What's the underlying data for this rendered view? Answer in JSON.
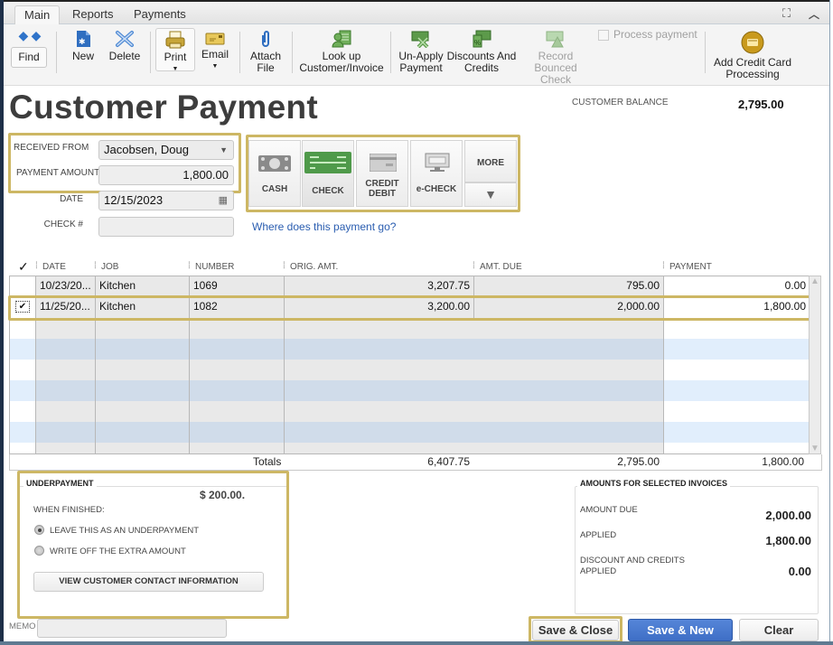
{
  "tabs": [
    {
      "label": "Main",
      "active": true
    },
    {
      "label": "Reports",
      "active": false
    },
    {
      "label": "Payments",
      "active": false
    }
  ],
  "window_icons": [
    "expand-icon",
    "collapse-icon"
  ],
  "toolbar": {
    "find": "Find",
    "new": "New",
    "delete": "Delete",
    "print": "Print",
    "email": "Email",
    "attach_1": "Attach",
    "attach_2": "File",
    "lookup_1": "Look up",
    "lookup_2": "Customer/Invoice",
    "unapply_1": "Un-Apply",
    "unapply_2": "Payment",
    "discounts_1": "Discounts And",
    "discounts_2": "Credits",
    "bounced_1": "Record",
    "bounced_2": "Bounced Check",
    "process_payment": "Process payment",
    "addcc_1": "Add Credit Card",
    "addcc_2": "Processing"
  },
  "header": {
    "title": "Customer Payment",
    "customer_balance_label": "CUSTOMER BALANCE",
    "customer_balance": "2,795.00"
  },
  "form": {
    "received_from_label": "RECEIVED FROM",
    "received_from": "Jacobsen, Doug",
    "payment_amount_label": "PAYMENT AMOUNT",
    "payment_amount": "1,800.00",
    "date_label": "DATE",
    "date": "12/15/2023",
    "check_no_label": "CHECK #",
    "check_no": "",
    "where_link": "Where does this payment go?"
  },
  "payment_methods": {
    "cash": "CASH",
    "check": "CHECK",
    "credit_1": "CREDIT",
    "credit_2": "DEBIT",
    "echeck": "e-CHECK",
    "more": "MORE",
    "selected": "CHECK"
  },
  "table": {
    "headers": {
      "check": "✓",
      "date": "DATE",
      "job": "JOB",
      "number": "NUMBER",
      "orig": "ORIG. AMT.",
      "due": "AMT. DUE",
      "payment": "PAYMENT"
    },
    "rows": [
      {
        "checked": false,
        "date": "10/23/20...",
        "job": "Kitchen",
        "number": "1069",
        "orig": "3,207.75",
        "due": "795.00",
        "payment": "0.00"
      },
      {
        "checked": true,
        "check_mark": "✔",
        "date": "11/25/20...",
        "job": "Kitchen",
        "number": "1082",
        "orig": "3,200.00",
        "due": "2,000.00",
        "payment": "1,800.00"
      }
    ],
    "totals": {
      "label": "Totals",
      "orig": "6,407.75",
      "due": "2,795.00",
      "payment": "1,800.00"
    }
  },
  "underpayment": {
    "title": "UNDERPAYMENT",
    "amount": "$ 200.00.",
    "when_finished": "WHEN FINISHED:",
    "option_leave": "LEAVE THIS AS AN UNDERPAYMENT",
    "option_writeoff": "WRITE OFF THE EXTRA AMOUNT",
    "selected_option": "LEAVE THIS AS AN UNDERPAYMENT",
    "view_contact": "VIEW CUSTOMER CONTACT INFORMATION"
  },
  "amounts_selected": {
    "title": "AMOUNTS FOR SELECTED INVOICES",
    "amount_due_label": "AMOUNT DUE",
    "amount_due": "2,000.00",
    "applied_label": "APPLIED",
    "applied": "1,800.00",
    "discount_label_1": "DISCOUNT AND CREDITS",
    "discount_label_2": "APPLIED",
    "discount": "0.00"
  },
  "memo": {
    "label": "MEMO",
    "value": ""
  },
  "footer": {
    "save_close": "Save & Close",
    "save_new": "Save & New",
    "clear": "Clear"
  },
  "colors": {
    "highlight": "#cdb764",
    "primary_button": "#3f6fc6",
    "link": "#2a5db0"
  }
}
